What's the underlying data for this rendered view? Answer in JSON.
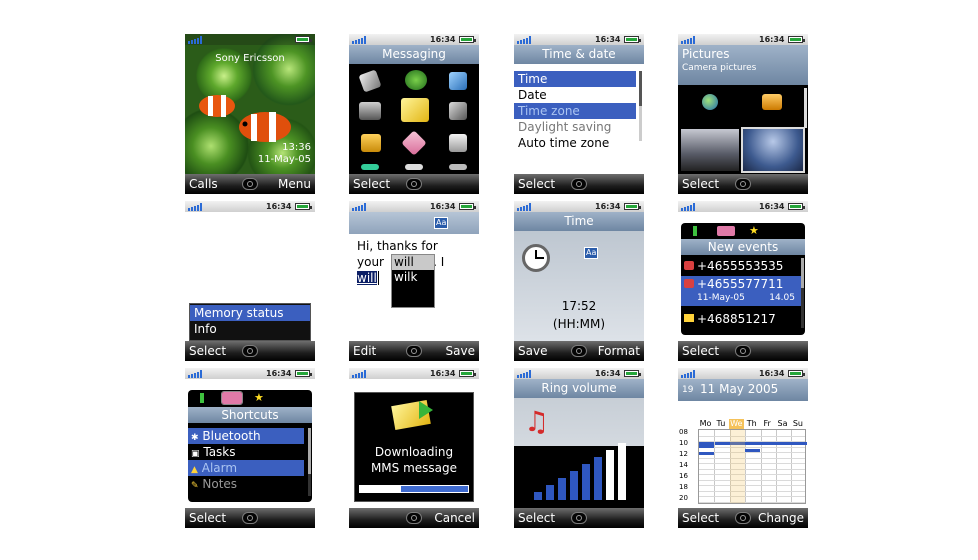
{
  "status": {
    "time": "16:34"
  },
  "p1": {
    "brand": "Sony Ericsson",
    "clock_time": "13:36",
    "clock_date": "11-May-05",
    "left": "Calls",
    "right": "Menu"
  },
  "p2": {
    "title": "Messaging",
    "left": "Select"
  },
  "p3": {
    "title": "Time & date",
    "items": [
      "Time",
      "Date",
      "Time zone",
      "Daylight saving",
      "Auto time zone"
    ],
    "left": "Select"
  },
  "p4": {
    "title": "Pictures",
    "subtitle": "Camera pictures",
    "left": "Select"
  },
  "p5": {
    "items": [
      "Memory status",
      "Info"
    ],
    "left": "Select"
  },
  "p6": {
    "mode_icon": "Aa",
    "line1": "Hi, thanks for",
    "line2_a": "your ",
    "line2_b": "e. I",
    "typed": "will",
    "suggestions": [
      "will",
      "wilk"
    ],
    "left": "Edit",
    "right": "Save"
  },
  "p7": {
    "title": "Time",
    "mode_icon": "Aa",
    "value": "17:52",
    "format": "(HH:MM)",
    "left": "Save",
    "right": "Format"
  },
  "p8": {
    "title": "New events",
    "events": [
      {
        "icon": "missed-call-icon",
        "number": "+4655553535"
      },
      {
        "icon": "missed-call-icon",
        "number": "+4655577711",
        "date": "11-May-05",
        "time": "14.05"
      },
      {
        "icon": "message-icon",
        "number": "+468851217"
      }
    ],
    "left": "Select"
  },
  "p9": {
    "title": "Shortcuts",
    "items": [
      "Bluetooth",
      "Tasks",
      "Alarm",
      "Notes"
    ],
    "left": "Select"
  },
  "p10": {
    "line1": "Downloading",
    "line2": "MMS message",
    "progress": 0.38,
    "right": "Cancel"
  },
  "p11": {
    "title": "Ring volume",
    "level": 0.75,
    "bars": 8,
    "left": "Select"
  },
  "p12": {
    "week": "19",
    "date": "11 May 2005",
    "days": [
      "Mo",
      "Tu",
      "We",
      "Th",
      "Fr",
      "Sa",
      "Su"
    ],
    "hours": [
      "08",
      "10",
      "12",
      "14",
      "16",
      "18",
      "20"
    ],
    "left": "Select",
    "right": "Change"
  },
  "colors": {
    "highlight": "#3b5fbf",
    "titlebar": "#8aa0b8",
    "status_green": "#26a63a"
  }
}
